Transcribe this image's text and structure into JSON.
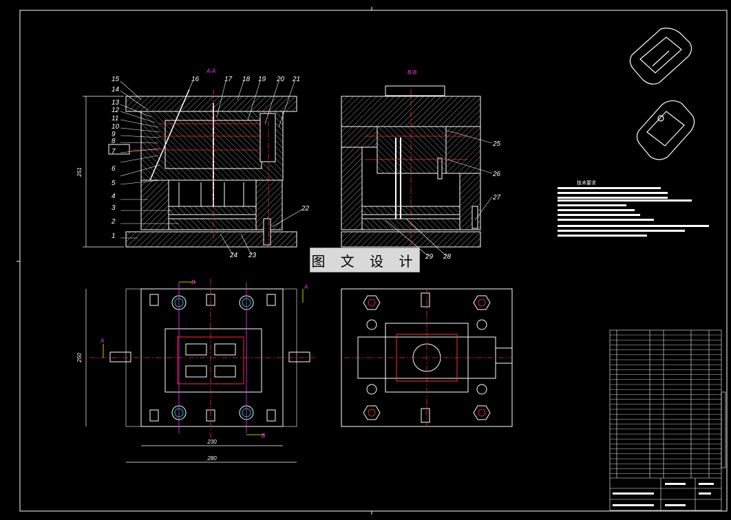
{
  "drawing": {
    "section_aa": "A-A",
    "section_bb": "B-B",
    "part_numbers_left": [
      "15",
      "14",
      "13",
      "12",
      "11",
      "10",
      "9",
      "8",
      "7",
      "6",
      "5",
      "4",
      "3",
      "2",
      "1"
    ],
    "part_numbers_top": [
      "16",
      "17",
      "18",
      "19",
      "20",
      "21"
    ],
    "part_numbers_bottom": [
      "24",
      "23"
    ],
    "part_22": "22",
    "part_numbers_right": [
      "25",
      "26",
      "27"
    ],
    "part_numbers_bb_bottom": [
      "29",
      "28"
    ],
    "dim_height": "251",
    "dim_plan_height": "250",
    "dim_inner_width": "230",
    "dim_outer_width": "280",
    "marker_a": "A",
    "marker_b": "B",
    "watermark": "图 文 设 计",
    "tech_req_title": "技术要求"
  },
  "colors": {
    "background": "#000000",
    "line": "#ffffff",
    "accent_magenta": "#ff33ff",
    "accent_red": "#ff3030",
    "accent_yellow": "#ffff00",
    "accent_cyan": "#00ffff"
  }
}
